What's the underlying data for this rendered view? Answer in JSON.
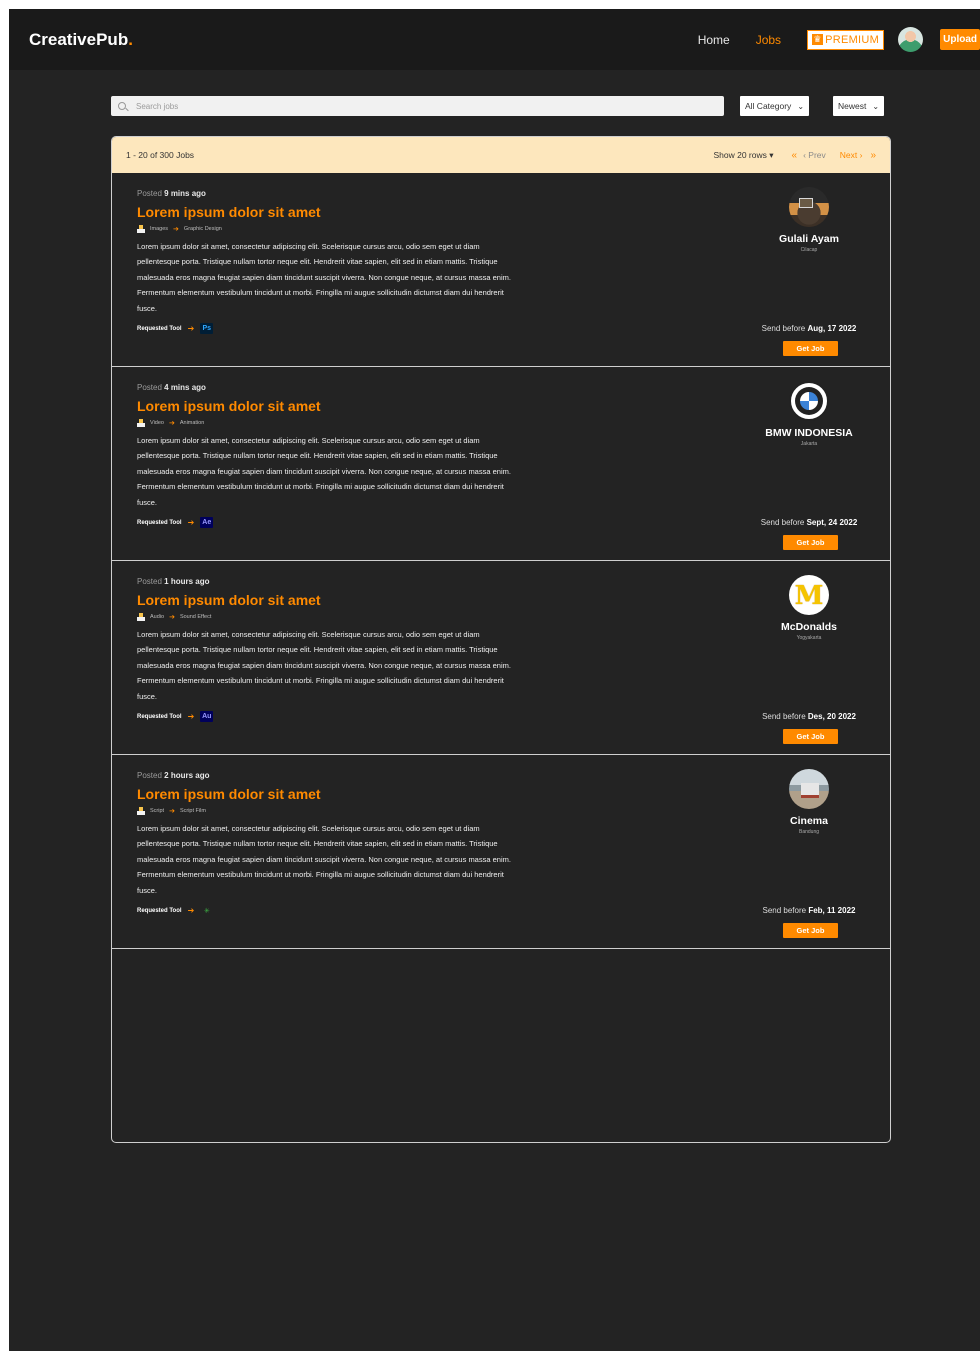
{
  "nav": {
    "brand": "CreativePub",
    "brand_dot": ".",
    "links": [
      "Home",
      "Jobs"
    ],
    "premium": "PREMIUM",
    "upload": "Upload"
  },
  "toolbar": {
    "search_placeholder": "Search jobs",
    "category": "All Category",
    "sort": "Newest"
  },
  "list": {
    "count": "1 - 20 of 300 Jobs",
    "rows": "Show 20 rows",
    "first": "«",
    "prev": "‹ Prev",
    "next": "Next ›",
    "last": "»"
  },
  "jobs": [
    {
      "posted_prefix": "Posted",
      "posted": "9 mins ago",
      "title": "Lorem ipsum dolor sit amet",
      "category": "Images",
      "subcategory": "Graphic Design",
      "desc1": "Lorem ipsum dolor sit amet, consectetur adipiscing elit. Scelerisque cursus arcu, odio sem eget ut diam",
      "desc2": "pellentesque porta. Tristique nullam tortor neque elit. Hendrerit vitae sapien, elit sed in etiam mattis. Tristique",
      "desc3": "malesuada eros magna feugiat sapien diam tincidunt suscipit viverra. Non congue neque, at cursus massa enim.",
      "desc4": "Fermentum elementum vestibulum tincidunt ut morbi. Fringilla mi augue sollicitudin dictumst diam dui hendrerit",
      "desc5": "fusce.",
      "tool_label": "Requested Tool",
      "tool": "Ps",
      "tool_bg": "#001e36",
      "tool_fg": "#31a8ff",
      "company": "Gulali Ayam",
      "city": "Cilacap",
      "deadline_prefix": "Send before",
      "deadline": "Aug, 17 2022",
      "button": "Get Job"
    },
    {
      "posted_prefix": "Posted",
      "posted": "4 mins ago",
      "title": "Lorem ipsum dolor sit amet",
      "category": "Video",
      "subcategory": "Animation",
      "desc1": "Lorem ipsum dolor sit amet, consectetur adipiscing elit. Scelerisque cursus arcu, odio sem eget ut diam",
      "desc2": "pellentesque porta. Tristique nullam tortor neque elit. Hendrerit vitae sapien, elit sed in etiam mattis. Tristique",
      "desc3": "malesuada eros magna feugiat sapien diam tincidunt suscipit viverra. Non congue neque, at cursus massa enim.",
      "desc4": "Fermentum elementum vestibulum tincidunt ut morbi. Fringilla mi augue sollicitudin dictumst diam dui hendrerit",
      "desc5": "fusce.",
      "tool_label": "Requested Tool",
      "tool": "Ae",
      "tool_bg": "#00005b",
      "tool_fg": "#9999ff",
      "company": "BMW INDONESIA",
      "city": "Jakarta",
      "deadline_prefix": "Send before",
      "deadline": "Sept, 24 2022",
      "button": "Get Job"
    },
    {
      "posted_prefix": "Posted",
      "posted": "1 hours ago",
      "title": "Lorem ipsum dolor sit amet",
      "category": "Audio",
      "subcategory": "Sound Effect",
      "desc1": "Lorem ipsum dolor sit amet, consectetur adipiscing elit. Scelerisque cursus arcu, odio sem eget ut diam",
      "desc2": "pellentesque porta. Tristique nullam tortor neque elit. Hendrerit vitae sapien, elit sed in etiam mattis. Tristique",
      "desc3": "malesuada eros magna feugiat sapien diam tincidunt suscipit viverra. Non congue neque, at cursus massa enim.",
      "desc4": "Fermentum elementum vestibulum tincidunt ut morbi. Fringilla mi augue sollicitudin dictumst diam dui hendrerit",
      "desc5": "fusce.",
      "tool_label": "Requested Tool",
      "tool": "Au",
      "tool_bg": "#00005b",
      "tool_fg": "#9999ff",
      "company": "McDonalds",
      "city": "Yogyakarta",
      "deadline_prefix": "Send before",
      "deadline": "Des, 20 2022",
      "button": "Get Job"
    },
    {
      "posted_prefix": "Posted",
      "posted": "2 hours ago",
      "title": "Lorem ipsum dolor sit amet",
      "category": "Script",
      "subcategory": "Script Film",
      "desc1": "Lorem ipsum dolor sit amet, consectetur adipiscing elit. Scelerisque cursus arcu, odio sem eget ut diam",
      "desc2": "pellentesque porta. Tristique nullam tortor neque elit. Hendrerit vitae sapien, elit sed in etiam mattis. Tristique",
      "desc3": "malesuada eros magna feugiat sapien diam tincidunt suscipit viverra. Non congue neque, at cursus massa enim.",
      "desc4": "Fermentum elementum vestibulum tincidunt ut morbi. Fringilla mi augue sollicitudin dictumst diam dui hendrerit",
      "desc5": "fusce.",
      "tool_label": "Requested Tool",
      "tool": "✳",
      "tool_bg": "transparent",
      "tool_fg": "#3cb043",
      "company": "Cinema",
      "city": "Bandung",
      "deadline_prefix": "Send before",
      "deadline": "Feb, 11 2022",
      "button": "Get Job"
    }
  ],
  "colors": {
    "accent": "#ff8a00",
    "background": "#232323",
    "header_bg": "#fde7bd"
  },
  "icons": [
    "search-icon",
    "chevron-down-icon",
    "crown-icon",
    "category-icon",
    "arrow-right-icon",
    "double-chevron-left-icon",
    "double-chevron-right-icon"
  ]
}
